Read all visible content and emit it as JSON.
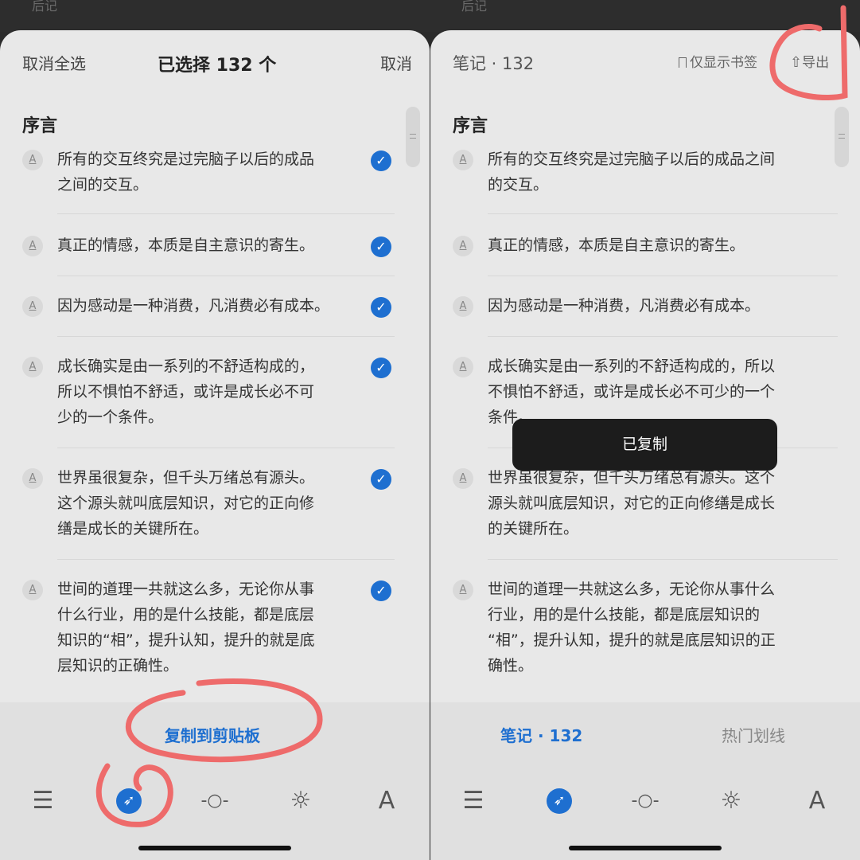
{
  "top_strip": {
    "left_text": "后记",
    "right_text": "后记"
  },
  "left_panel": {
    "header": {
      "deselect_all": "取消全选",
      "title": "已选择 132 个",
      "cancel": "取消"
    },
    "section_title": "序言",
    "items": [
      {
        "text": "所有的交互终究是过完脑子以后的成品\n之间的交互。",
        "checked": true
      },
      {
        "text": "真正的情感，本质是自主意识的寄生。",
        "checked": true
      },
      {
        "text": "因为感动是一种消费，凡消费必有成本。",
        "checked": true
      },
      {
        "text": "成长确实是由一系列的不舒适构成的，\n所以不惧怕不舒适，或许是成长必不可\n少的一个条件。",
        "checked": true
      },
      {
        "text": "世界虽很复杂，但千头万绪总有源头。\n这个源头就叫底层知识，对它的正向修\n缮是成长的关键所在。",
        "checked": true
      },
      {
        "text": "世间的道理一共就这么多，无论你从事\n什么行业，用的是什么技能，都是底层\n知识的“相”，提升认知，提升的就是底\n层知识的正确性。",
        "checked": true
      }
    ],
    "action": "复制到剪贴板"
  },
  "right_panel": {
    "header": {
      "title": "笔记 · 132",
      "bookmarks_only": "仅显示书签",
      "export": "导出"
    },
    "section_title": "序言",
    "items": [
      {
        "text": "所有的交互终究是过完脑子以后的成品之间\n的交互。"
      },
      {
        "text": "真正的情感，本质是自主意识的寄生。"
      },
      {
        "text": "因为感动是一种消费，凡消费必有成本。"
      },
      {
        "text": "成长确实是由一系列的不舒适构成的，所以\n不惧怕不舒适，或许是成长必不可少的一个\n条件。"
      },
      {
        "text": "世界虽很复杂，但千头万绪总有源头。这个\n源头就叫底层知识，对它的正向修缮是成长\n的关键所在。"
      },
      {
        "text": "世间的道理一共就这么多，无论你从事什么\n行业，用的是什么技能，都是底层知识的\n“相”，提升认知，提升的就是底层知识的正\n确性。"
      }
    ],
    "toast": "已复制",
    "tabs": {
      "notes": "笔记 · 132",
      "hot": "热门划线"
    }
  },
  "toolbar": {
    "menu_icon": "☰",
    "compass_icon": "➶",
    "progress_icon": "-○-",
    "brightness_icon": "☼",
    "font_icon": "A"
  },
  "icons": {
    "item_icon": "A",
    "check_icon": "✓"
  },
  "colors": {
    "accent": "#1e6fd0",
    "annotation": "#ee6b6b"
  }
}
